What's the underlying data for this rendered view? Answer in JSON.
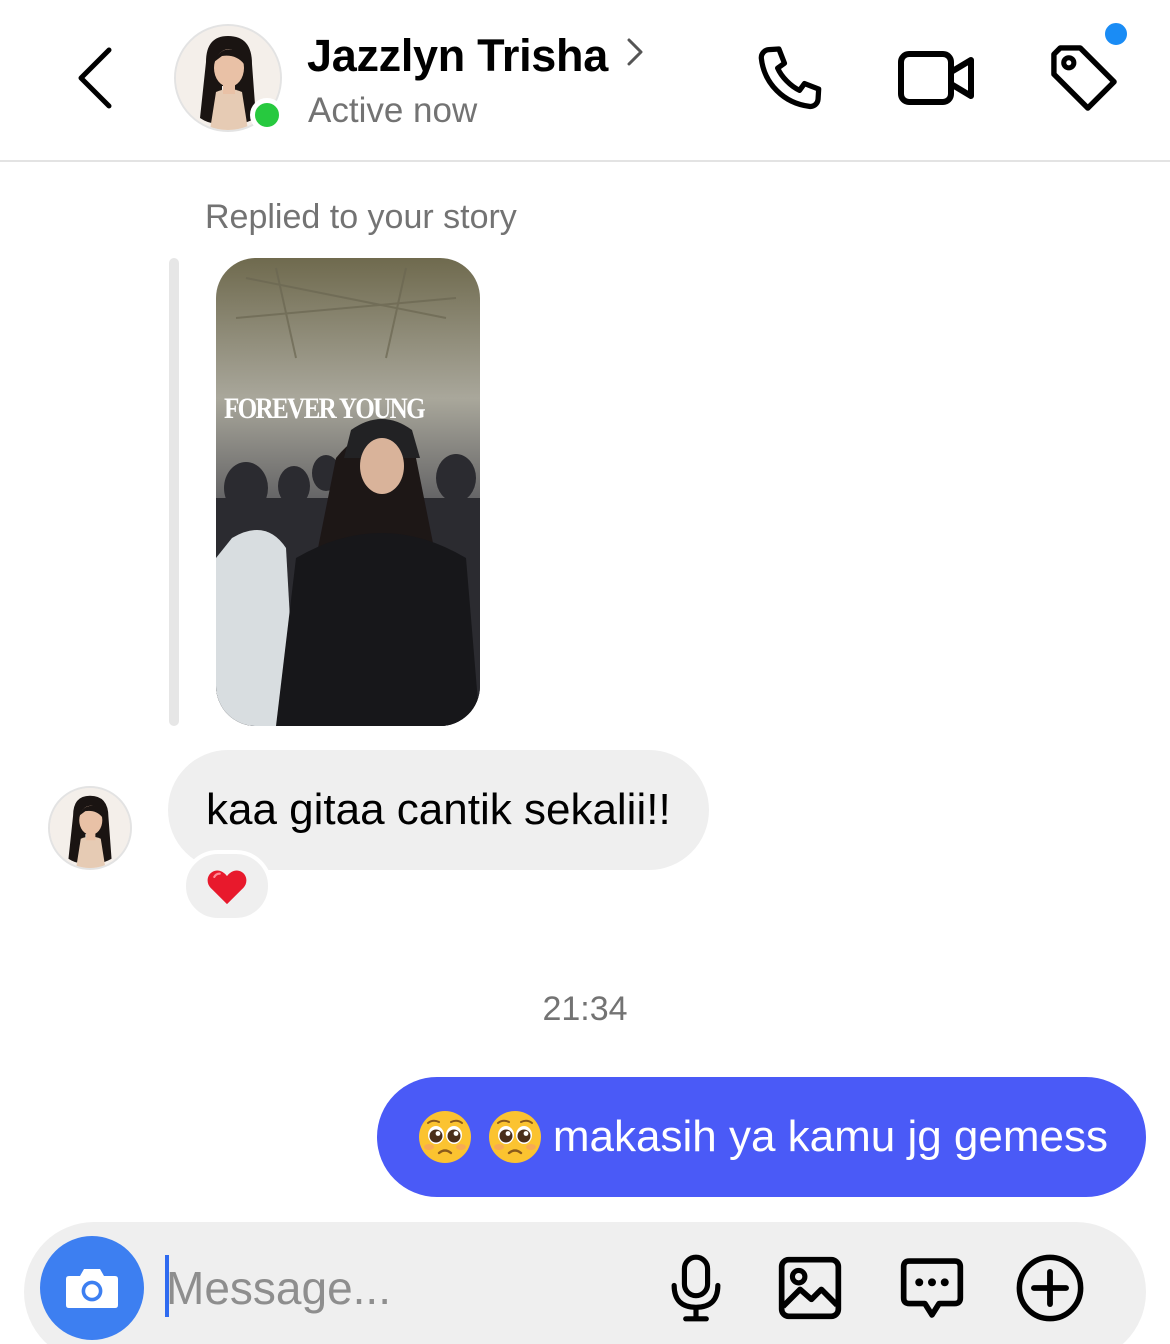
{
  "header": {
    "contact_name": "Jazzlyn Trisha",
    "status": "Active now",
    "icons": [
      "back-icon",
      "chevron-right-icon",
      "phone-icon",
      "video-camera-icon",
      "tag-icon"
    ]
  },
  "conversation": {
    "reply_caption": "Replied to your story",
    "story_text": "FOREVER YOUNG",
    "incoming_message": "kaa gitaa cantik sekalii!!",
    "reaction": "❤️",
    "timestamp": "21:34",
    "outgoing_message": "makasih ya kamu jg gemess",
    "outgoing_emojis": [
      "pleading-face-emoji",
      "pleading-face-emoji"
    ]
  },
  "composer": {
    "placeholder": "Message...",
    "icons": [
      "camera-icon",
      "microphone-icon",
      "gallery-icon",
      "sticker-chat-icon",
      "plus-circle-icon"
    ]
  },
  "colors": {
    "outgoing_bubble": "#4a5af7",
    "incoming_bubble": "#efefef",
    "online_dot": "#27c93f",
    "notification_dot": "#1a8cf5",
    "camera_button": "#3d7ff1"
  }
}
